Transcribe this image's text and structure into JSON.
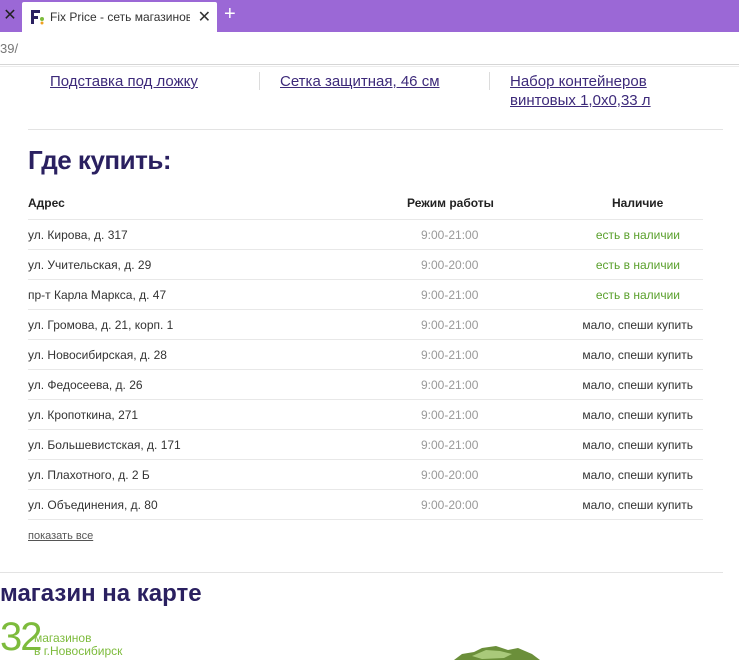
{
  "browser": {
    "tab_title": "Fix Price - сеть магазинов",
    "address": "39/"
  },
  "related_products": [
    {
      "label": "Подставка под ложку"
    },
    {
      "label": "Сетка защитная, 46 см"
    },
    {
      "label_line1": "Набор контейнеров",
      "label_line2": "винтовых 1,0х0,33 л"
    }
  ],
  "where_to_buy": {
    "title": "Где купить:",
    "columns": {
      "address": "Адрес",
      "hours": "Режим работы",
      "availability": "Наличие"
    },
    "rows": [
      {
        "address": "ул. Кирова, д. 317",
        "hours": "9:00-21:00",
        "availability": "есть в наличии",
        "in_stock": true
      },
      {
        "address": "ул. Учительская, д. 29",
        "hours": "9:00-20:00",
        "availability": "есть в наличии",
        "in_stock": true
      },
      {
        "address": "пр-т Карла Маркса, д. 47",
        "hours": "9:00-21:00",
        "availability": "есть в наличии",
        "in_stock": true
      },
      {
        "address": "ул. Громова, д. 21, корп. 1",
        "hours": "9:00-21:00",
        "availability": "мало, спеши купить",
        "in_stock": false
      },
      {
        "address": "ул. Новосибирская, д. 28",
        "hours": "9:00-21:00",
        "availability": "мало, спеши купить",
        "in_stock": false
      },
      {
        "address": "ул. Федосеева, д. 26",
        "hours": "9:00-21:00",
        "availability": "мало, спеши купить",
        "in_stock": false
      },
      {
        "address": "ул. Кропоткина, 271",
        "hours": "9:00-21:00",
        "availability": "мало, спеши купить",
        "in_stock": false
      },
      {
        "address": "ул. Большевистская, д. 171",
        "hours": "9:00-21:00",
        "availability": "мало, спеши купить",
        "in_stock": false
      },
      {
        "address": "ул. Плахотного, д. 2 Б",
        "hours": "9:00-20:00",
        "availability": "мало, спеши купить",
        "in_stock": false
      },
      {
        "address": "ул. Объединения, д. 80",
        "hours": "9:00-20:00",
        "availability": "мало, спеши купить",
        "in_stock": false
      }
    ],
    "show_all": "показать все"
  },
  "map_section": {
    "title": "магазин на карте",
    "count": "32",
    "count_line1": "магазинов",
    "count_line2": "в г.Новосибирск"
  },
  "colors": {
    "tabbar": "#9b68d6",
    "heading": "#2a2060",
    "in_stock": "#5aa02c",
    "low_stock": "#333333",
    "accent_green": "#7dbb3c"
  }
}
